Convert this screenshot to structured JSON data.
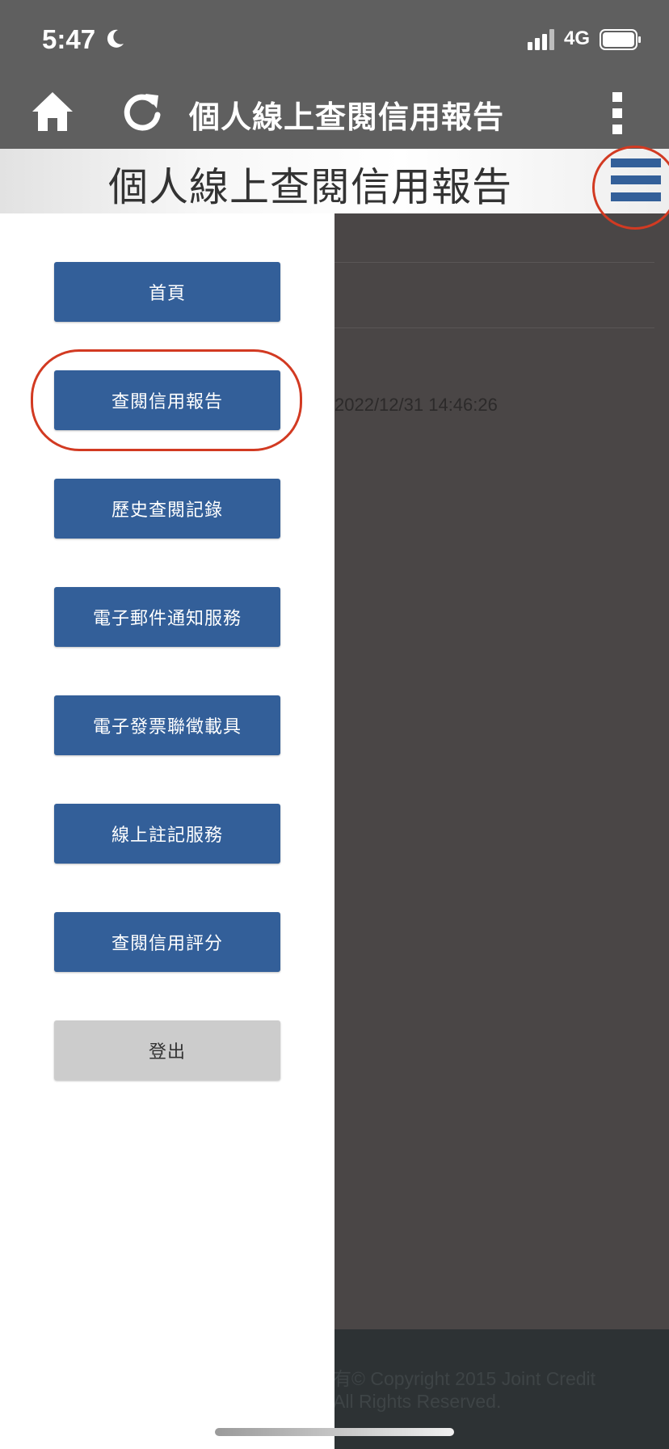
{
  "status_bar": {
    "time": "5:47",
    "network": "4G"
  },
  "app_bar": {
    "title": "個人線上查閱信用報告"
  },
  "banner": {
    "title": "個人線上查閱信用報告"
  },
  "content": {
    "timestamp": "2022/12/31 14:46:26"
  },
  "menu": {
    "items": [
      {
        "label": "首頁"
      },
      {
        "label": "查閱信用報告"
      },
      {
        "label": "歷史查閱記錄"
      },
      {
        "label": "電子郵件通知服務"
      },
      {
        "label": "電子發票聯徵載具"
      },
      {
        "label": "線上註記服務"
      },
      {
        "label": "查閱信用評分"
      }
    ],
    "logout_label": "登出"
  },
  "footer": {
    "line1": "有© Copyright 2015 Joint Credit",
    "line2": "All Rights Reserved."
  },
  "colors": {
    "app_bar": "#5f5f5f",
    "menu_button": "#335f99",
    "logout_button": "#cccccc",
    "annotation": "#d23a22",
    "overlay": "#4a4646",
    "footer": "#2d3234"
  }
}
